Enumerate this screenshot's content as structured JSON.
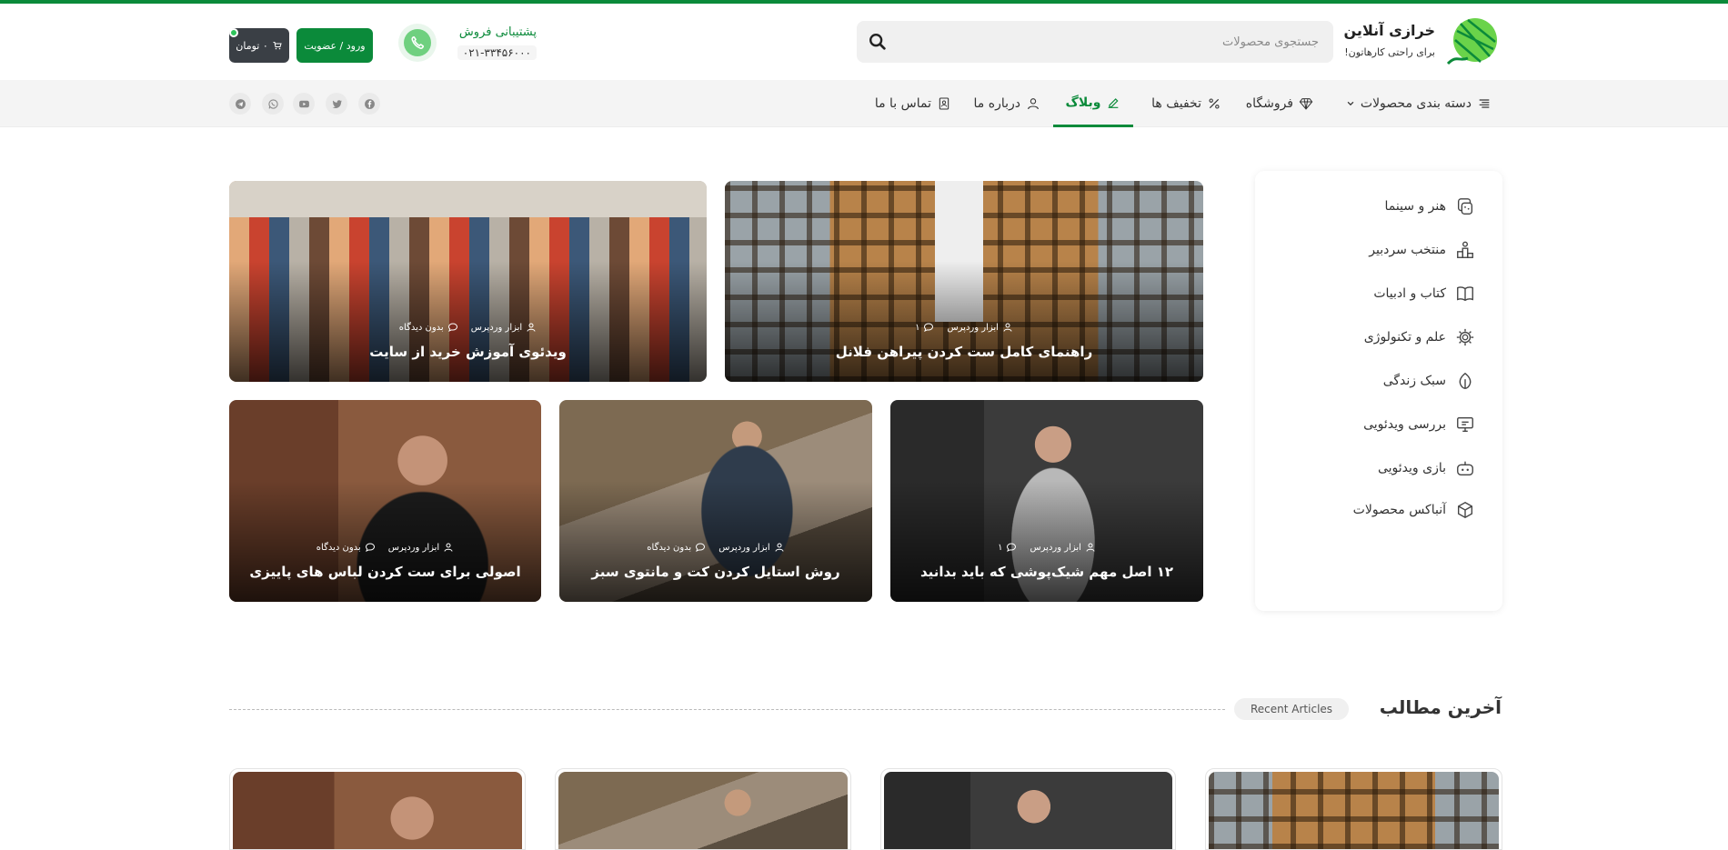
{
  "brand": {
    "name": "خرازی آنلاین",
    "tagline": "برای راحتی کارهاتون!",
    "accent": "#0b8a3a"
  },
  "search": {
    "placeholder": "جستجوی محصولات"
  },
  "support": {
    "label": "پشتیبانی فروش",
    "phone": "۰۲۱-۳۳۴۵۶۰۰۰"
  },
  "auth": {
    "login_label": "ورود / عضویت"
  },
  "cart": {
    "label": "۰ تومان"
  },
  "nav": {
    "items": [
      {
        "label": "دسته بندی محصولات",
        "icon": "menu-icon"
      },
      {
        "label": "فروشگاه",
        "icon": "diamond-icon"
      },
      {
        "label": "تخفیف ها",
        "icon": "percent-icon"
      },
      {
        "label": "وبلاگ",
        "icon": "edit-icon",
        "active": true
      },
      {
        "label": "درباره ما",
        "icon": "user-icon"
      },
      {
        "label": "تماس با ما",
        "icon": "contact-book-icon"
      }
    ],
    "social": [
      "facebook-icon",
      "twitter-icon",
      "youtube-icon",
      "whatsapp-icon",
      "telegram-icon"
    ]
  },
  "categories": [
    {
      "label": "هنر و سینما",
      "icon": "palette-icon"
    },
    {
      "label": "منتخب سردبیر",
      "icon": "podium-icon"
    },
    {
      "label": "کتاب و ادبیات",
      "icon": "book-icon"
    },
    {
      "label": "علم و تکنولوژی",
      "icon": "cpu-icon"
    },
    {
      "label": "سبک زندگی",
      "icon": "leaf-icon"
    },
    {
      "label": "بررسی ویدئویی",
      "icon": "monitor-icon"
    },
    {
      "label": "بازی ویدئویی",
      "icon": "gamepad-icon"
    },
    {
      "label": "آنباکس محصولات",
      "icon": "box-icon"
    }
  ],
  "featured": [
    {
      "title": "راهنمای کامل ست کردن پیراهن فلانل",
      "author": "ابزار وردپرس",
      "comments": "۱"
    },
    {
      "title": "ویدئوی آموزش خرید از سایت",
      "author": "ابزار وردپرس",
      "comments": "بدون دیدگاه"
    },
    {
      "title": "۱۲ اصل مهم شیک‌پوشی که باید بدانید",
      "author": "ابزار وردپرس",
      "comments": "۱"
    },
    {
      "title": "روش استایل کردن کت و مانتوی سبز",
      "author": "ابزار وردپرس",
      "comments": "بدون دیدگاه"
    },
    {
      "title": "اصولی برای ست کردن لباس های پاییزی",
      "author": "ابزار وردپرس",
      "comments": "بدون دیدگاه"
    }
  ],
  "latest": {
    "title": "آخرین مطالب",
    "subtitle": "Recent Articles"
  }
}
